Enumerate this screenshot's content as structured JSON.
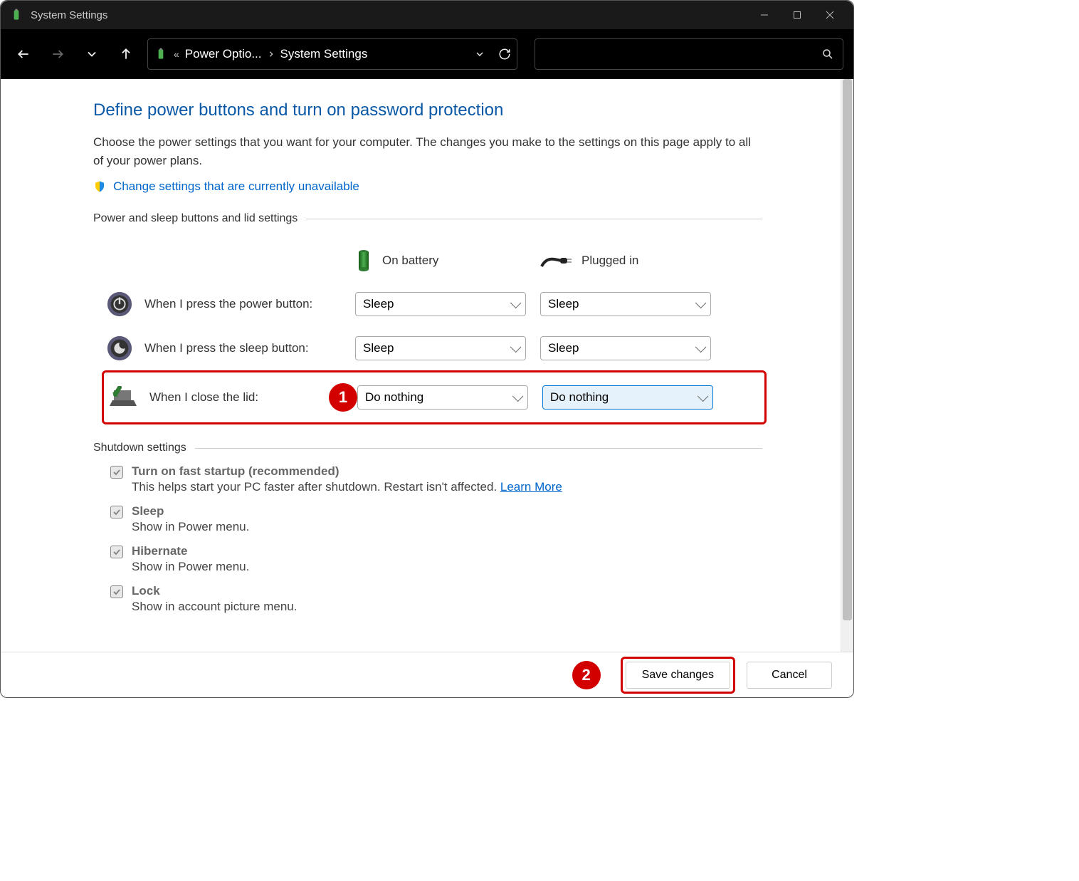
{
  "titlebar": {
    "title": "System Settings"
  },
  "nav": {
    "breadcrumb": {
      "prefix_symbol": "«",
      "item1": "Power Optio...",
      "item2": "System Settings"
    }
  },
  "page": {
    "title": "Define power buttons and turn on password protection",
    "description": "Choose the power settings that you want for your computer. The changes you make to the settings on this page apply to all of your power plans.",
    "admin_link": "Change settings that are currently unavailable",
    "section1_label": "Power and sleep buttons and lid settings",
    "columns": {
      "battery": "On battery",
      "plugged": "Plugged in"
    },
    "rows": {
      "power_btn": {
        "label": "When I press the power button:",
        "battery": "Sleep",
        "plugged": "Sleep"
      },
      "sleep_btn": {
        "label": "When I press the sleep button:",
        "battery": "Sleep",
        "plugged": "Sleep"
      },
      "lid": {
        "label": "When I close the lid:",
        "battery": "Do nothing",
        "plugged": "Do nothing"
      }
    },
    "annotation1": "1",
    "section2_label": "Shutdown settings",
    "shutdown": {
      "fast_startup": {
        "title": "Turn on fast startup (recommended)",
        "desc": "This helps start your PC faster after shutdown. Restart isn't affected. ",
        "link": "Learn More"
      },
      "sleep": {
        "title": "Sleep",
        "desc": "Show in Power menu."
      },
      "hibernate": {
        "title": "Hibernate",
        "desc": "Show in Power menu."
      },
      "lock": {
        "title": "Lock",
        "desc": "Show in account picture menu."
      }
    }
  },
  "footer": {
    "annotation2": "2",
    "save_label": "Save changes",
    "cancel_label": "Cancel"
  }
}
